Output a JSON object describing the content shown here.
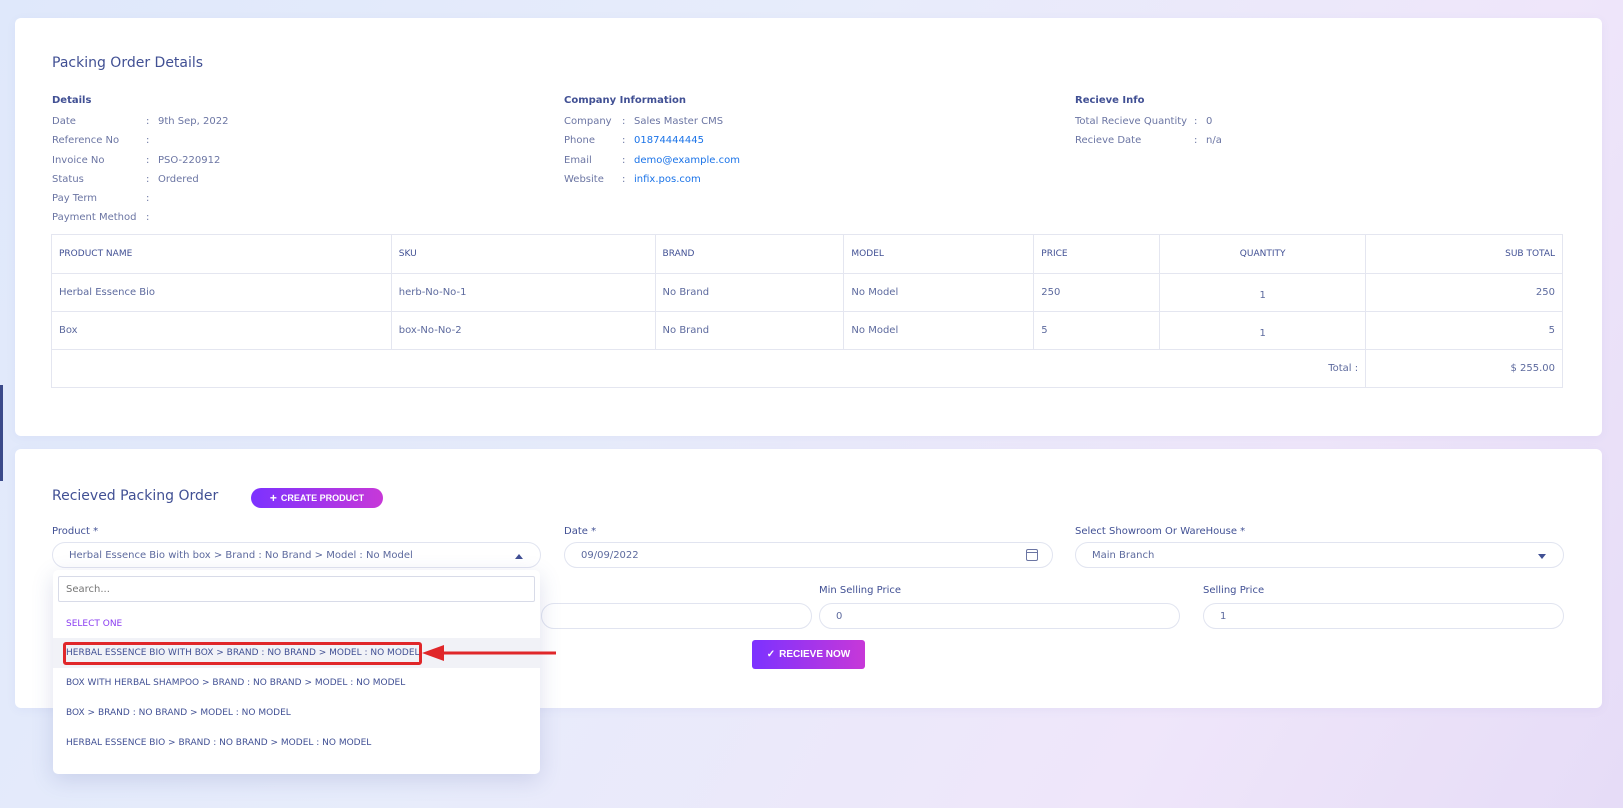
{
  "page_title": "Packing Order Details",
  "details": {
    "heading": "Details",
    "rows": [
      {
        "label": "Date",
        "value": "9th Sep, 2022"
      },
      {
        "label": "Reference No",
        "value": ""
      },
      {
        "label": "Invoice No",
        "value": "PSO-220912"
      },
      {
        "label": "Status",
        "value": "Ordered"
      },
      {
        "label": "Pay Term",
        "value": ""
      },
      {
        "label": "Payment Method",
        "value": ""
      }
    ]
  },
  "company": {
    "heading": "Company Information",
    "rows": [
      {
        "label": "Company",
        "value": "Sales Master CMS"
      },
      {
        "label": "Phone",
        "value": "01874444445"
      },
      {
        "label": "Email",
        "value": "demo@example.com"
      },
      {
        "label": "Website",
        "value": "infix.pos.com"
      }
    ]
  },
  "receive_info": {
    "heading": "Recieve Info",
    "rows": [
      {
        "label": "Total Recieve Quantity",
        "value": "0"
      },
      {
        "label": "Recieve Date",
        "value": "n/a"
      }
    ]
  },
  "table": {
    "headers": [
      "PRODUCT NAME",
      "SKU",
      "BRAND",
      "MODEL",
      "PRICE",
      "QUANTITY",
      "SUB TOTAL"
    ],
    "rows": [
      [
        "Herbal Essence Bio",
        "herb-No-No-1",
        "No Brand",
        "No Model",
        "250",
        "1",
        "250"
      ],
      [
        "Box",
        "box-No-No-2",
        "No Brand",
        "No Model",
        "5",
        "1",
        "5"
      ]
    ],
    "total_label": "Total :",
    "total_value": "$ 255.00"
  },
  "received": {
    "title": "Recieved Packing Order",
    "create_button": "CREATE PRODUCT",
    "product_label": "Product *",
    "product_value": "Herbal Essence Bio with box > Brand : No Brand > Model : No Model",
    "date_label": "Date *",
    "date_value": "09/09/2022",
    "showroom_label": "Select Showroom Or WareHouse *",
    "showroom_value": "Main Branch",
    "min_price_label": "Min Selling Price",
    "min_price_value": "0",
    "selling_price_label": "Selling Price",
    "selling_price_value": "1",
    "receive_button": "RECIEVE NOW"
  },
  "dropdown": {
    "search_placeholder": "Search...",
    "items": [
      "SELECT ONE",
      "HERBAL ESSENCE BIO WITH BOX > BRAND : NO BRAND > MODEL : NO MODEL",
      "BOX WITH HERBAL SHAMPOO > BRAND : NO BRAND > MODEL : NO MODEL",
      "BOX > BRAND : NO BRAND > MODEL : NO MODEL",
      "HERBAL ESSENCE BIO > BRAND : NO BRAND > MODEL : NO MODEL"
    ]
  },
  "colors": {
    "accent_gradient_start": "#7c32ff",
    "accent_gradient_end": "#c738d8",
    "text_primary": "#415094",
    "annotation_red": "#e0272a"
  }
}
